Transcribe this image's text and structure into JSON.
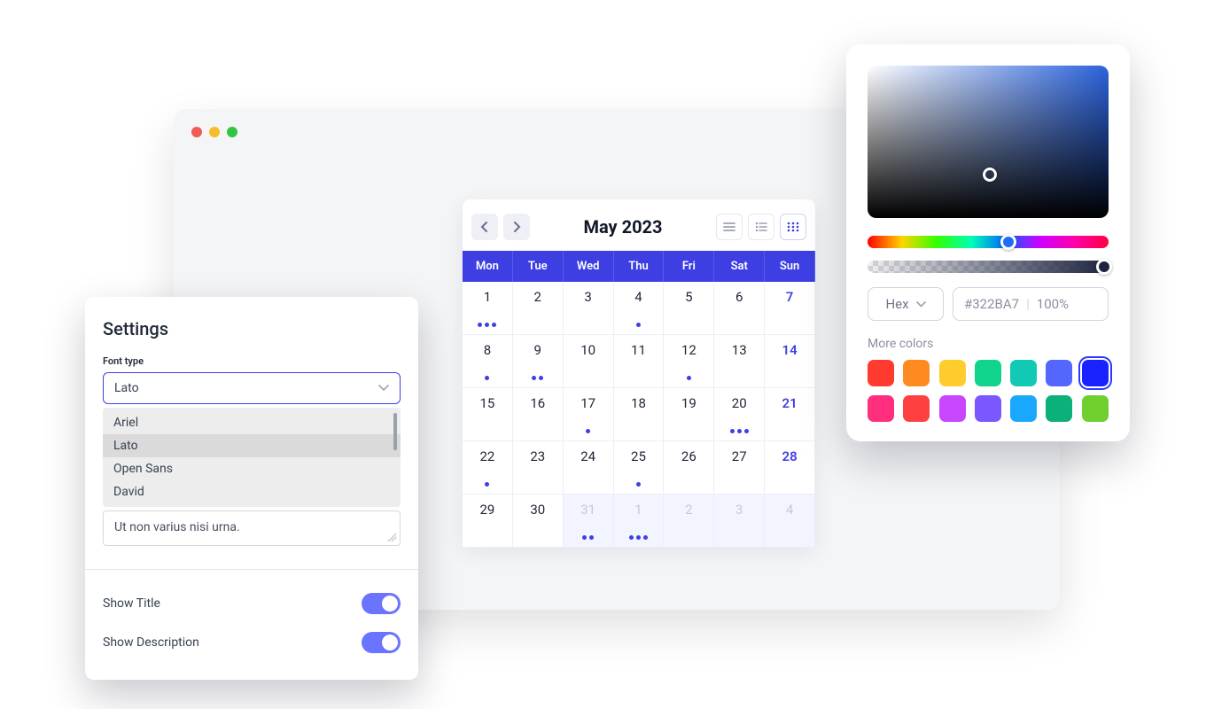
{
  "calendar": {
    "title": "May 2023",
    "dow": [
      "Mon",
      "Tue",
      "Wed",
      "Thu",
      "Fri",
      "Sat",
      "Sun"
    ],
    "days": [
      {
        "n": "1",
        "dots": 3
      },
      {
        "n": "2"
      },
      {
        "n": "3"
      },
      {
        "n": "4",
        "dots": 1
      },
      {
        "n": "5"
      },
      {
        "n": "6"
      },
      {
        "n": "7",
        "sunday": true
      },
      {
        "n": "8",
        "dots": 1
      },
      {
        "n": "9",
        "dots": 2
      },
      {
        "n": "10"
      },
      {
        "n": "11"
      },
      {
        "n": "12",
        "dots": 1
      },
      {
        "n": "13"
      },
      {
        "n": "14",
        "sunday": true
      },
      {
        "n": "15"
      },
      {
        "n": "16"
      },
      {
        "n": "17",
        "dots": 1
      },
      {
        "n": "18"
      },
      {
        "n": "19"
      },
      {
        "n": "20",
        "dots": 3
      },
      {
        "n": "21",
        "sunday": true
      },
      {
        "n": "22",
        "dots": 1
      },
      {
        "n": "23"
      },
      {
        "n": "24"
      },
      {
        "n": "25",
        "dots": 1
      },
      {
        "n": "26"
      },
      {
        "n": "27"
      },
      {
        "n": "28",
        "sunday": true
      },
      {
        "n": "29"
      },
      {
        "n": "30"
      },
      {
        "n": "31",
        "other": true,
        "dots": 2,
        "hl": true
      },
      {
        "n": "1",
        "other": true,
        "dots": 3,
        "hl": true
      },
      {
        "n": "2",
        "other": true,
        "hl": true
      },
      {
        "n": "3",
        "other": true,
        "hl": true
      },
      {
        "n": "4",
        "other": true,
        "hl": true
      }
    ]
  },
  "settings": {
    "title": "Settings",
    "font_label": "Font type",
    "font_value": "Lato",
    "font_options": [
      "Ariel",
      "Lato",
      "Open Sans",
      "David"
    ],
    "textarea": "Ut non varius nisi urna.",
    "show_title": "Show Title",
    "show_description": "Show Description"
  },
  "colorpicker": {
    "format": "Hex",
    "hex": "#322BA7",
    "opacity": "100%",
    "more_label": "More colors",
    "swatches": [
      "#ff3b30",
      "#ff8a1f",
      "#ffcc2e",
      "#10d48b",
      "#12c9b3",
      "#5367ff",
      "#1a22ff",
      "#ff2f7e",
      "#ff4040",
      "#c946ff",
      "#7a57ff",
      "#1aa8ff",
      "#0bb07a",
      "#6fcf2f"
    ],
    "active_swatch": 6
  }
}
